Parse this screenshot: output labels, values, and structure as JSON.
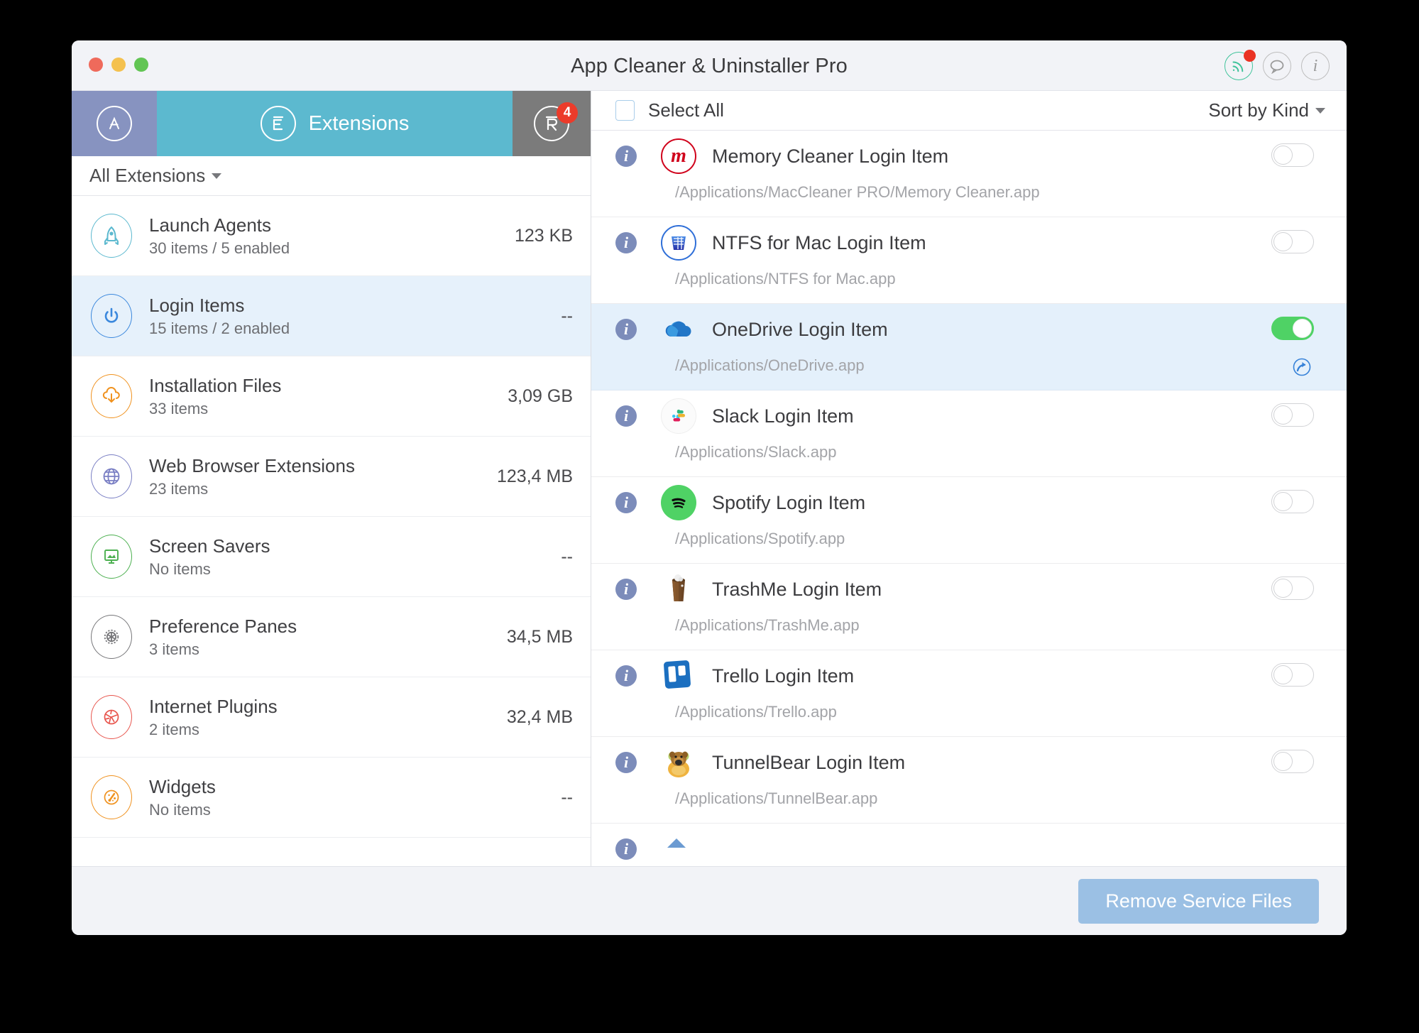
{
  "window": {
    "title": "App Cleaner & Uninstaller Pro",
    "traffic_lights": [
      "close",
      "minimize",
      "zoom"
    ],
    "title_icons": [
      {
        "name": "rss-signal-icon",
        "badge": true
      },
      {
        "name": "speech-bubble-icon",
        "badge": false
      },
      {
        "name": "info-icon",
        "badge": false
      }
    ]
  },
  "tabs": [
    {
      "id": "applications",
      "label": "",
      "icon": "applications-a-icon",
      "badge": "",
      "active": false
    },
    {
      "id": "extensions",
      "label": "Extensions",
      "icon": "extensions-e-icon",
      "badge": "",
      "active": true
    },
    {
      "id": "remains",
      "label": "",
      "icon": "remains-r-icon",
      "badge": "4",
      "active": false
    }
  ],
  "sidebar": {
    "filter_label": "All Extensions",
    "items": [
      {
        "title": "Launch Agents",
        "subtitle": "30 items / 5 enabled",
        "size": "123 KB",
        "icon": "rocket-icon",
        "color": "#5cb9cf",
        "selected": false
      },
      {
        "title": "Login Items",
        "subtitle": "15 items / 2 enabled",
        "size": "--",
        "icon": "power-icon",
        "color": "#3b88dd",
        "selected": true
      },
      {
        "title": "Installation Files",
        "subtitle": "33 items",
        "size": "3,09 GB",
        "icon": "cloud-download-icon",
        "color": "#f0921f",
        "selected": false
      },
      {
        "title": "Web Browser Extensions",
        "subtitle": "23 items",
        "size": "123,4 MB",
        "icon": "globe-icon",
        "color": "#7a7fc4",
        "selected": false
      },
      {
        "title": "Screen Savers",
        "subtitle": "No items",
        "size": "--",
        "icon": "screen-saver-icon",
        "color": "#4cb050",
        "selected": false
      },
      {
        "title": "Preference Panes",
        "subtitle": "3 items",
        "size": "34,5 MB",
        "icon": "gear-icon",
        "color": "#767679",
        "selected": false
      },
      {
        "title": "Internet Plugins",
        "subtitle": "2 items",
        "size": "32,4 MB",
        "icon": "plugin-globe-icon",
        "color": "#e8564e",
        "selected": false
      },
      {
        "title": "Widgets",
        "subtitle": "No items",
        "size": "--",
        "icon": "widget-gauge-icon",
        "color": "#f0921f",
        "selected": false
      }
    ]
  },
  "main": {
    "select_all_label": "Select All",
    "select_all_checked": false,
    "sort_label": "Sort by Kind",
    "items": [
      {
        "name": "Memory Cleaner Login Item",
        "path": "/Applications/MacCleaner PRO/Memory Cleaner.app",
        "icon": "memory-cleaner-icon",
        "enabled": false,
        "selected": false
      },
      {
        "name": "NTFS for Mac Login Item",
        "path": "/Applications/NTFS for Mac.app",
        "icon": "ntfs-for-mac-icon",
        "enabled": false,
        "selected": false
      },
      {
        "name": "OneDrive Login Item",
        "path": "/Applications/OneDrive.app",
        "icon": "onedrive-icon",
        "enabled": true,
        "selected": true
      },
      {
        "name": "Slack Login Item",
        "path": "/Applications/Slack.app",
        "icon": "slack-icon",
        "enabled": false,
        "selected": false
      },
      {
        "name": "Spotify Login Item",
        "path": "/Applications/Spotify.app",
        "icon": "spotify-icon",
        "enabled": false,
        "selected": false
      },
      {
        "name": "TrashMe Login Item",
        "path": "/Applications/TrashMe.app",
        "icon": "trashme-icon",
        "enabled": false,
        "selected": false
      },
      {
        "name": "Trello Login Item",
        "path": "/Applications/Trello.app",
        "icon": "trello-icon",
        "enabled": false,
        "selected": false
      },
      {
        "name": "TunnelBear Login Item",
        "path": "/Applications/TunnelBear.app",
        "icon": "tunnelbear-icon",
        "enabled": false,
        "selected": false
      }
    ]
  },
  "footer": {
    "remove_button_label": "Remove Service Files"
  },
  "colors": {
    "tab_active": "#5cb9cf",
    "tab_apps": "#8793c0",
    "tab_remains": "#7b7b7b",
    "selection": "#e4f0fb",
    "toggle_on": "#4fd265",
    "badge": "#ec3b2a",
    "primary_button": "#9bc0e4"
  }
}
